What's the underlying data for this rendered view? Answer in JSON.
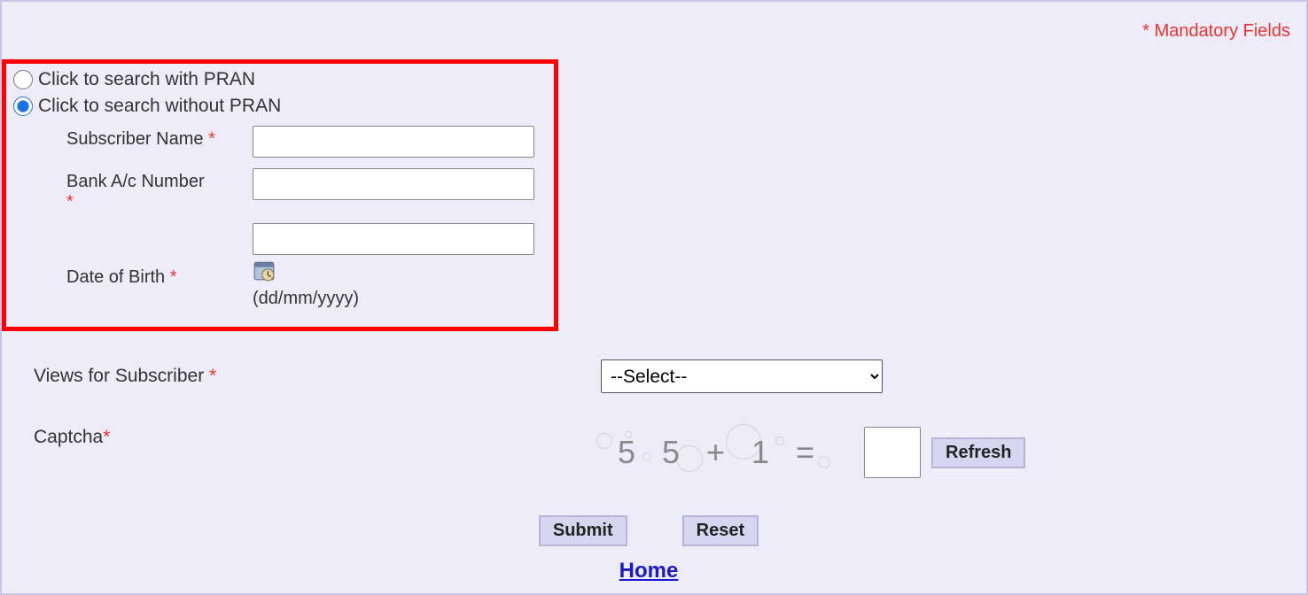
{
  "header": {
    "mandatory_note": "* Mandatory Fields"
  },
  "search": {
    "radio_with_pran": "Click to search with PRAN",
    "radio_without_pran": "Click to search without PRAN",
    "subscriber_name_label": "Subscriber Name",
    "bank_acc_label": "Bank A/c Number",
    "dob_label": "Date of Birth",
    "dob_hint": "(dd/mm/yyyy)"
  },
  "views": {
    "label": "Views for Subscriber",
    "selected": "--Select--"
  },
  "captcha": {
    "label": "Captcha",
    "expression": "5 5 + 1 =",
    "refresh_btn": "Refresh"
  },
  "buttons": {
    "submit": "Submit",
    "reset": "Reset"
  },
  "footer": {
    "home": "Home"
  },
  "asterisk": "*"
}
